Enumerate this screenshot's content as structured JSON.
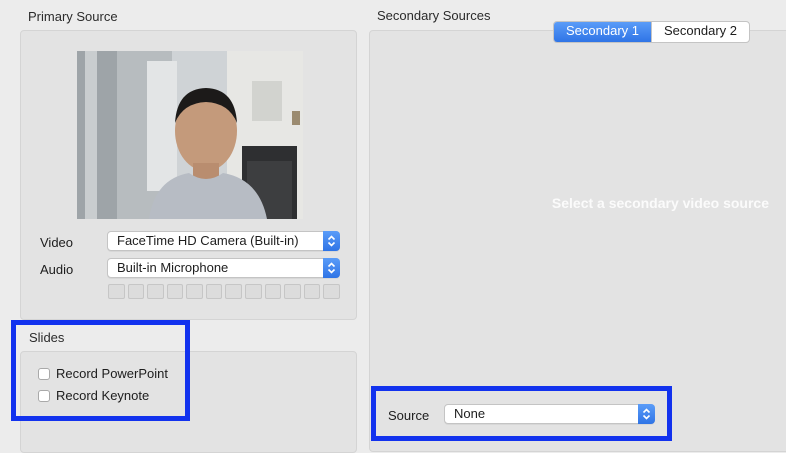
{
  "primary": {
    "title": "Primary Source",
    "video_label": "Video",
    "video_value": "FaceTime HD Camera (Built-in)",
    "audio_label": "Audio",
    "audio_value": "Built-in Microphone",
    "audio_level": 0
  },
  "slides": {
    "title": "Slides",
    "record_powerpoint": "Record PowerPoint",
    "record_keynote": "Record Keynote"
  },
  "secondary": {
    "title": "Secondary Sources",
    "tabs": [
      {
        "label": "Secondary 1",
        "active": true
      },
      {
        "label": "Secondary 2",
        "active": false
      }
    ],
    "placeholder": "Select a secondary video source",
    "source_label": "Source",
    "source_value": "None"
  },
  "colors": {
    "accent": "#2f74e6",
    "highlight": "#1232ee"
  }
}
